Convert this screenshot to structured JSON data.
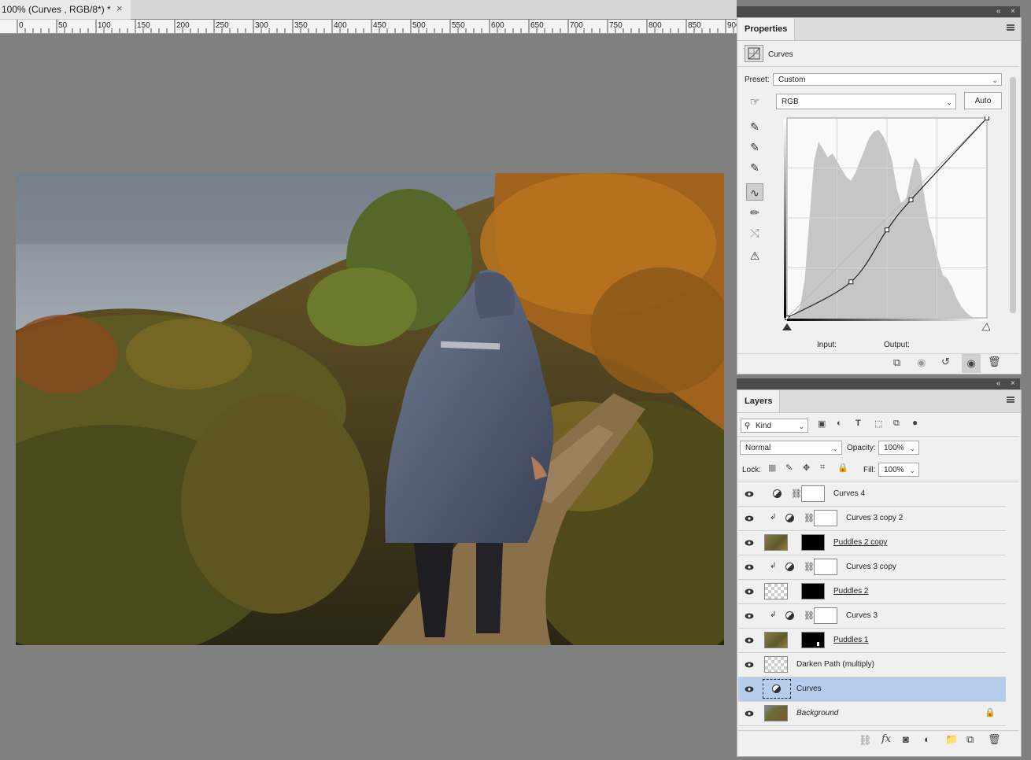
{
  "document": {
    "tab_title": "100% (Curves , RGB/8*) *",
    "close_glyph": "×",
    "ruler_labels": [
      "0",
      "50",
      "100",
      "150",
      "200",
      "250",
      "300",
      "350",
      "400",
      "450",
      "500",
      "550",
      "600",
      "650",
      "700",
      "750",
      "800",
      "850",
      "900"
    ]
  },
  "properties": {
    "tab_label": "Properties",
    "adjustment_label": "Curves",
    "preset_label": "Preset:",
    "preset_value": "Custom",
    "channel_value": "RGB",
    "auto_label": "Auto",
    "input_label": "Input:",
    "output_label": "Output:",
    "curve_points": [
      [
        0,
        0
      ],
      [
        64,
        36
      ],
      [
        100,
        88
      ],
      [
        124,
        118
      ],
      [
        200,
        200
      ]
    ],
    "colors": {
      "histogram": "#c6c6c6",
      "curve": "#222222",
      "grid": "#d4d4d4"
    }
  },
  "layers": {
    "tab_label": "Layers",
    "filter_kind": "Kind",
    "blend_mode": "Normal",
    "opacity_label": "Opacity:",
    "opacity_value": "100%",
    "lock_label": "Lock:",
    "fill_label": "Fill:",
    "fill_value": "100%",
    "items": [
      {
        "name": "Curves 4",
        "type": "adjustment",
        "clipped": false,
        "selected": false
      },
      {
        "name": "Curves 3 copy 2",
        "type": "adjustment",
        "clipped": true,
        "selected": false
      },
      {
        "name": "Puddles 2 copy",
        "type": "image-mask",
        "clipped": false,
        "selected": false
      },
      {
        "name": "Curves 3 copy",
        "type": "adjustment",
        "clipped": true,
        "selected": false
      },
      {
        "name": "Puddles 2",
        "type": "empty-mask",
        "clipped": false,
        "selected": false
      },
      {
        "name": "Curves 3",
        "type": "adjustment",
        "clipped": true,
        "selected": false
      },
      {
        "name": "Puddles 1",
        "type": "image-mask",
        "clipped": false,
        "selected": false
      },
      {
        "name": "Darken Path (multiply)",
        "type": "transparent",
        "clipped": false,
        "selected": false
      },
      {
        "name": "Curves",
        "type": "adjustment",
        "clipped": false,
        "selected": true
      },
      {
        "name": "Background",
        "type": "background",
        "clipped": false,
        "selected": false
      }
    ],
    "colors": {
      "selected_row": "#b3cdea"
    }
  }
}
